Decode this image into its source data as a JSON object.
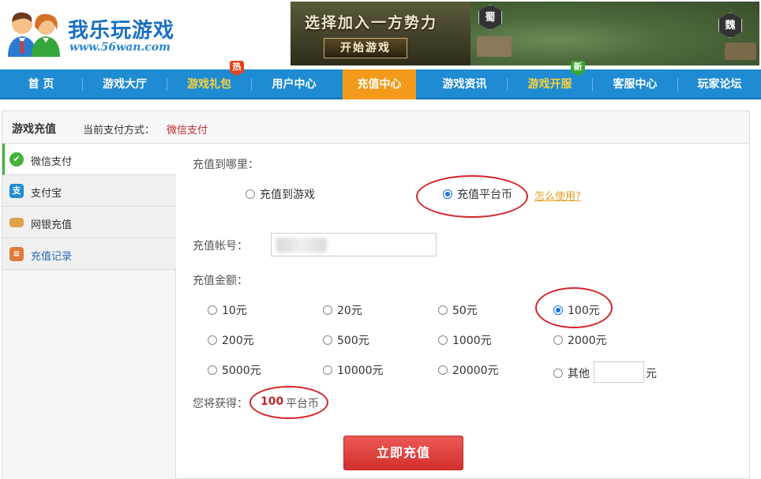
{
  "brand": {
    "name": "我乐玩游戏",
    "url": "www.56wan.com"
  },
  "banner": {
    "slogan": "选择加入一方势力",
    "start_button": "开始游戏",
    "factions": [
      "蜀",
      "魏"
    ]
  },
  "nav": {
    "items": [
      {
        "label": "首 页"
      },
      {
        "label": "游戏大厅"
      },
      {
        "label": "游戏礼包"
      },
      {
        "label": "用户中心"
      },
      {
        "label": "充值中心"
      },
      {
        "label": "游戏资讯"
      },
      {
        "label": "游戏开服"
      },
      {
        "label": "客服中心"
      },
      {
        "label": "玩家论坛"
      }
    ],
    "active": "充值中心",
    "badges": {
      "hot": "热",
      "new": "新"
    }
  },
  "panel": {
    "title": "游戏充值",
    "pay_label": "当前支付方式：",
    "pay_value": "微信支付"
  },
  "sidebar": {
    "items": [
      {
        "label": "微信支付"
      },
      {
        "label": "支付宝"
      },
      {
        "label": "网银充值"
      },
      {
        "label": "充值记录"
      }
    ],
    "active": "微信支付"
  },
  "form": {
    "target_label": "充值到哪里：",
    "target_options": [
      {
        "label": "充值到游戏",
        "checked": false
      },
      {
        "label": "充值平台币",
        "checked": true
      }
    ],
    "howto": "怎么使用?",
    "account_label": "充值帐号：",
    "amount_label": "充值金额：",
    "amounts": [
      {
        "label": "10元",
        "checked": false
      },
      {
        "label": "20元",
        "checked": false
      },
      {
        "label": "50元",
        "checked": false
      },
      {
        "label": "100元",
        "checked": true
      },
      {
        "label": "200元",
        "checked": false
      },
      {
        "label": "500元",
        "checked": false
      },
      {
        "label": "1000元",
        "checked": false
      },
      {
        "label": "2000元",
        "checked": false
      },
      {
        "label": "5000元",
        "checked": false
      },
      {
        "label": "10000元",
        "checked": false
      },
      {
        "label": "20000元",
        "checked": false
      }
    ],
    "other_label": "其他",
    "other_unit": "元",
    "gain_label": "您将获得：",
    "gain_value": "100",
    "gain_unit": "平台币",
    "submit": "立即充值"
  },
  "colors": {
    "nav_bg": "#1e8bd3",
    "nav_active": "#f39a1a",
    "nav_gold": "#ffd23a",
    "accent_red": "#c0292e",
    "annotation": "#d6262b",
    "wechat_green": "#43b33c"
  }
}
